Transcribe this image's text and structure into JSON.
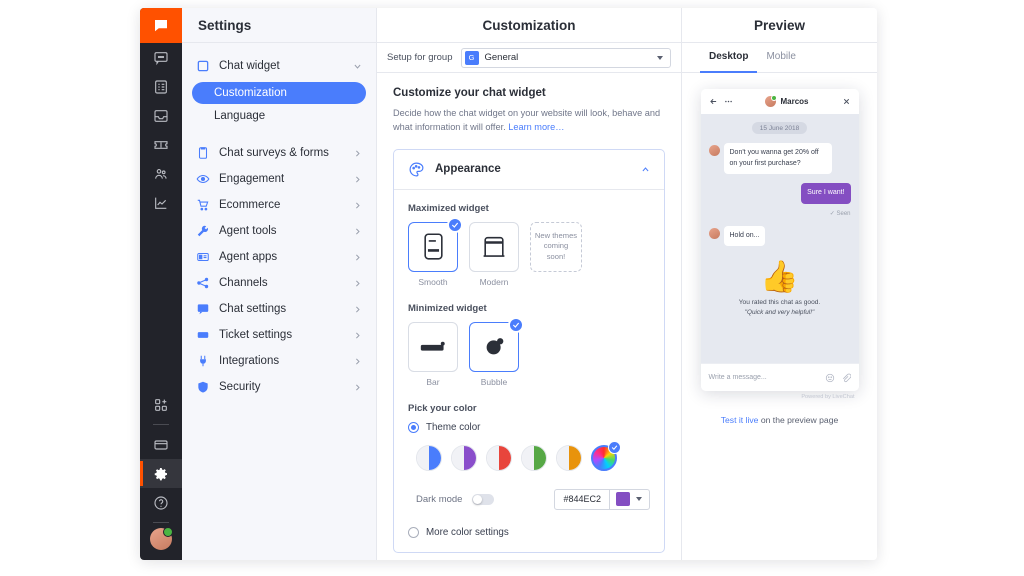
{
  "rail": {
    "logo_icon": "livechat-logo-icon",
    "items": [
      {
        "name": "chats-icon"
      },
      {
        "name": "archives-icon"
      },
      {
        "name": "inbox-icon"
      },
      {
        "name": "tickets-icon"
      },
      {
        "name": "team-icon"
      },
      {
        "name": "reports-icon"
      }
    ],
    "lower_items": [
      {
        "name": "apps-add-icon"
      },
      {
        "name": "billing-icon"
      },
      {
        "name": "settings-gear-icon"
      },
      {
        "name": "help-icon"
      }
    ],
    "avatar": "user-avatar"
  },
  "nav": {
    "title": "Settings",
    "group": {
      "label": "Chat widget",
      "icon": "chat-widget-icon",
      "chevron": "chevron-down-icon",
      "children": [
        {
          "label": "Customization",
          "selected": true
        },
        {
          "label": "Language",
          "selected": false
        }
      ]
    },
    "items": [
      {
        "label": "Chat surveys & forms",
        "icon": "clipboard-icon"
      },
      {
        "label": "Engagement",
        "icon": "eye-icon"
      },
      {
        "label": "Ecommerce",
        "icon": "cart-icon"
      },
      {
        "label": "Agent tools",
        "icon": "wrench-icon"
      },
      {
        "label": "Agent apps",
        "icon": "agent-apps-icon"
      },
      {
        "label": "Channels",
        "icon": "channels-icon"
      },
      {
        "label": "Chat settings",
        "icon": "chat-settings-icon"
      },
      {
        "label": "Ticket settings",
        "icon": "ticket-settings-icon"
      },
      {
        "label": "Integrations",
        "icon": "plug-icon"
      },
      {
        "label": "Security",
        "icon": "shield-icon"
      }
    ]
  },
  "center": {
    "title": "Customization",
    "setup_label": "Setup for group",
    "group_badge": "G",
    "group_value": "General",
    "heading": "Customize your chat widget",
    "description": "Decide how the chat widget on your website will look, behave and what information it will offer. ",
    "learn_more": "Learn more…",
    "card": {
      "title": "Appearance",
      "icon": "palette-icon",
      "collapse_icon": "chevron-up-icon"
    },
    "maximized_label": "Maximized widget",
    "maximized_options": [
      {
        "label": "Smooth",
        "selected": true
      },
      {
        "label": "Modern",
        "selected": false
      }
    ],
    "coming_soon": "New themes coming soon!",
    "minimized_label": "Minimized widget",
    "minimized_options": [
      {
        "label": "Bar",
        "selected": false
      },
      {
        "label": "Bubble",
        "selected": true
      }
    ],
    "pick_color_label": "Pick your color",
    "theme_color_label": "Theme color",
    "swatches": [
      {
        "name": "swatch-blue",
        "color": "#4a7dfc",
        "selected": false
      },
      {
        "name": "swatch-purple",
        "color": "#8a4ecb",
        "selected": false
      },
      {
        "name": "swatch-red",
        "color": "#e8453c",
        "selected": false
      },
      {
        "name": "swatch-green",
        "color": "#56a845",
        "selected": false
      },
      {
        "name": "swatch-orange",
        "color": "#e8930c",
        "selected": false
      },
      {
        "name": "swatch-custom-rainbow",
        "color": "rainbow",
        "selected": true
      }
    ],
    "dark_mode_label": "Dark mode",
    "dark_mode_on": false,
    "hex_value": "#844EC2",
    "accent_color": "#844EC2",
    "more_color_settings": "More color settings"
  },
  "preview": {
    "title": "Preview",
    "tabs": [
      {
        "label": "Desktop",
        "active": true
      },
      {
        "label": "Mobile",
        "active": false
      }
    ],
    "widget": {
      "back_icon": "back-arrow-icon",
      "menu_icon": "more-dots-icon",
      "agent_name": "Marcos",
      "close_icon": "close-icon",
      "date": "15 June 2018",
      "messages": [
        {
          "from": "agent",
          "text": "Don't you wanna get 20% off on your first purchase?"
        },
        {
          "from": "visitor",
          "text": "Sure I want!",
          "status": "Seen"
        },
        {
          "from": "agent",
          "text": "Hold on..."
        }
      ],
      "rating_emoji": "👍",
      "rating_text": "You rated this chat as good.",
      "rating_quote": "\"Quick and very helpful!\"",
      "input_placeholder": "Write a message...",
      "emoji_icon": "emoji-icon",
      "attach_icon": "attachment-icon",
      "powered_by": "Powered by LiveChat"
    },
    "test_link": "Test it live",
    "test_suffix": " on the preview page"
  }
}
